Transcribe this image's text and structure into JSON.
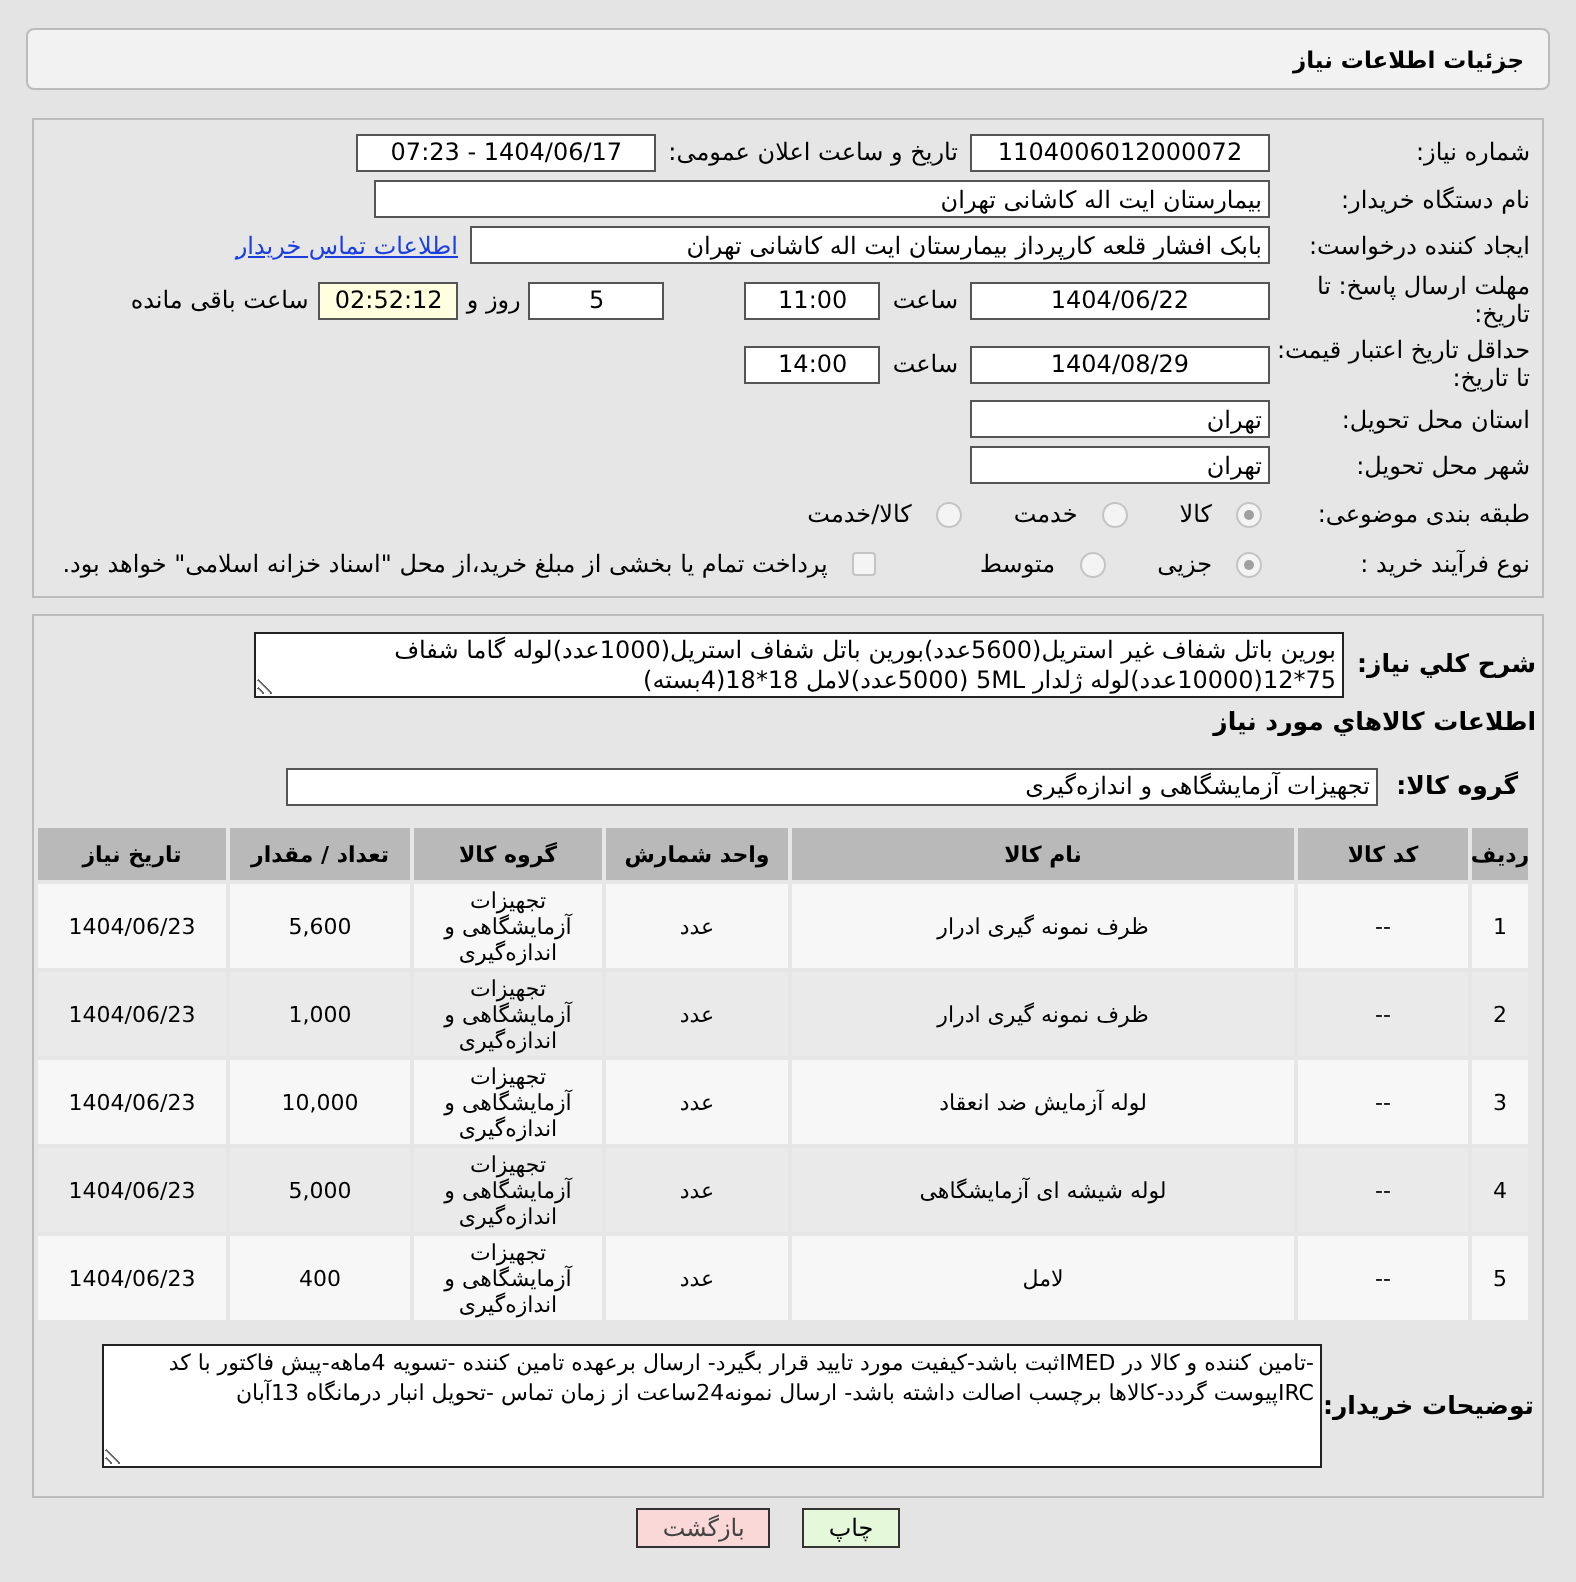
{
  "header": {
    "title": "جزئیات اطلاعات نیاز"
  },
  "need_number": {
    "label": "شماره نیاز:",
    "value": "1104006012000072"
  },
  "announce": {
    "label": "تاریخ و ساعت اعلان عمومی:",
    "value": "1404/06/17 - 07:23"
  },
  "buyer": {
    "label": "نام دستگاه خریدار:",
    "value": "بیمارستان ایت اله کاشانی تهران"
  },
  "requester": {
    "label": "ایجاد کننده درخواست:",
    "value": "بابک افشار قلعه کارپرداز بیمارستان ایت اله کاشانی تهران",
    "link": "اطلاعات تماس خریدار"
  },
  "deadline": {
    "label": "مهلت ارسال پاسخ: تا تاریخ:",
    "date": "1404/06/22",
    "time_label": "ساعت",
    "time": "11:00",
    "days": "5",
    "days_label": "روز و",
    "remaining": "02:52:12",
    "remaining_label": "ساعت باقی مانده"
  },
  "validity": {
    "label": "حداقل تاریخ اعتبار قیمت: تا تاریخ:",
    "date": "1404/08/29",
    "time_label": "ساعت",
    "time": "14:00"
  },
  "province": {
    "label": "استان محل تحویل:",
    "value": "تهران"
  },
  "city": {
    "label": "شهر محل تحویل:",
    "value": "تهران"
  },
  "category": {
    "label": "طبقه بندی موضوعی:",
    "options": [
      {
        "label": "کالا",
        "selected": true
      },
      {
        "label": "خدمت",
        "selected": false
      },
      {
        "label": "کالا/خدمت",
        "selected": false
      }
    ]
  },
  "process": {
    "label": "نوع فرآیند خرید :",
    "options": [
      {
        "label": "جزیی",
        "selected": true
      },
      {
        "label": "متوسط",
        "selected": false
      }
    ],
    "treasury": {
      "label": "پرداخت تمام یا بخشی از مبلغ خرید،از محل \"اسناد خزانه اسلامی\" خواهد بود.",
      "checked": false
    }
  },
  "description": {
    "label": "شرح کلي نياز:",
    "value": "بورین باتل شفاف غیر استریل(5600عدد)بورین باتل شفاف استریل(1000عدد)لوله گاما شفاف 75*12(10000عدد)لوله ژلدار 5ML (5000عدد)لامل 18*18(4بسته)"
  },
  "goods": {
    "title": "اطلاعات کالاهاي مورد نياز",
    "group_label": "گروه کالا:",
    "group": "تجهیزات آزمایشگاهی و اندازه‌گیری"
  },
  "table": {
    "columns": [
      "ردیف",
      "کد کالا",
      "نام کالا",
      "واحد شمارش",
      "گروه کالا",
      "تعداد / مقدار",
      "تاریخ نیاز"
    ],
    "rows": [
      [
        "1",
        "--",
        "ظرف نمونه گیری ادرار",
        "عدد",
        "تجهیزات آزمایشگاهی و اندازه‌گیری",
        "5,600",
        "1404/06/23"
      ],
      [
        "2",
        "--",
        "ظرف نمونه گیری ادرار",
        "عدد",
        "تجهیزات آزمایشگاهی و اندازه‌گیری",
        "1,000",
        "1404/06/23"
      ],
      [
        "3",
        "--",
        "لوله آزمایش ضد انعقاد",
        "عدد",
        "تجهیزات آزمایشگاهی و اندازه‌گیری",
        "10,000",
        "1404/06/23"
      ],
      [
        "4",
        "--",
        "لوله شیشه ای آزمایشگاهی",
        "عدد",
        "تجهیزات آزمایشگاهی و اندازه‌گیری",
        "5,000",
        "1404/06/23"
      ],
      [
        "5",
        "--",
        "لامل",
        "عدد",
        "تجهیزات آزمایشگاهی و اندازه‌گیری",
        "400",
        "1404/06/23"
      ]
    ]
  },
  "notes": {
    "label": "توضیحات خریدار:",
    "value": "-تامین کننده و کالا در IMEDثبت باشد-کیفیت مورد تایید قرار بگیرد- ارسال برعهده تامین کننده -تسویه 4ماهه-پیش فاکتور با کد IRCپیوست گردد-کالاها برچسب اصالت داشته باشد- ارسال نمونه24ساعت از زمان تماس -تحویل انبار درمانگاه 13آبان"
  },
  "buttons": [
    {
      "label": "چاپ",
      "kind": "print"
    },
    {
      "label": "بازگشت",
      "kind": "back"
    }
  ]
}
